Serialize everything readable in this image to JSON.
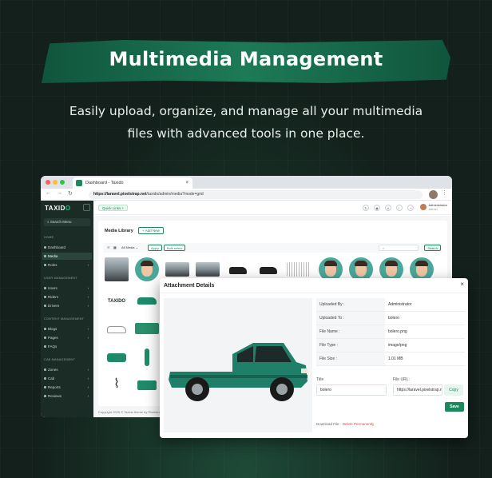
{
  "hero": {
    "title": "Multimedia Management",
    "subtitle_line1": "Easily upload, organize, and manage all your multimedia",
    "subtitle_line2": "files with advanced tools in one place."
  },
  "browser": {
    "tab_title": "Dashboard - Taxido",
    "url_bold": "https://laravel.pixelstrap.net",
    "url_rest": "/taxido/admin/media?mode=grid"
  },
  "sidebar": {
    "logo_a": "TAXID",
    "logo_b": "O",
    "search_placeholder": "Search Menu",
    "sections": {
      "home": "HOME",
      "user": "USER MANAGEMENT",
      "content": "CONTENT MANAGEMENT",
      "cab": "CAB MANAGEMENT"
    },
    "items": [
      "Dashboard",
      "Media",
      "Roles",
      "Users",
      "Riders",
      "Drivers",
      "Blogs",
      "Pages",
      "FAQs",
      "Zones",
      "Cab",
      "Reports",
      "Reviews"
    ]
  },
  "topbar": {
    "quick_links": "Quick Links +",
    "user_name": "Administrator",
    "user_role": "Admin"
  },
  "media_library": {
    "title": "Media Library",
    "add_new": "+ Add New",
    "filter_all": "All Media",
    "apply": "Apply",
    "bulk_select": "Bulk select",
    "search": "Search",
    "footer": "Copyright 2025 © Taxido theme by Pixelstrap"
  },
  "modal": {
    "title": "Attachment Details",
    "close": "×",
    "info": [
      {
        "label": "Uploaded By :",
        "value": "Administrator"
      },
      {
        "label": "Uploaded To :",
        "value": "bolero"
      },
      {
        "label": "File Name :",
        "value": "bolero.png"
      },
      {
        "label": "File Type :",
        "value": "image/png"
      },
      {
        "label": "File Size :",
        "value": "1.01 MB"
      }
    ],
    "title_label": "Title",
    "title_value": "bolero",
    "url_label": "File URL:",
    "url_value": "https://laravel.pixelstrap.net",
    "copy": "Copy",
    "save": "Save",
    "download": "Download File",
    "delete": "Delete Permanently"
  },
  "colors": {
    "brand_green": "#1a8a5e",
    "sidebar_bg": "#1b2b25",
    "hero_band": "#1d7a57",
    "page_bg": "#13201b",
    "car_body": "#1f7f68"
  }
}
